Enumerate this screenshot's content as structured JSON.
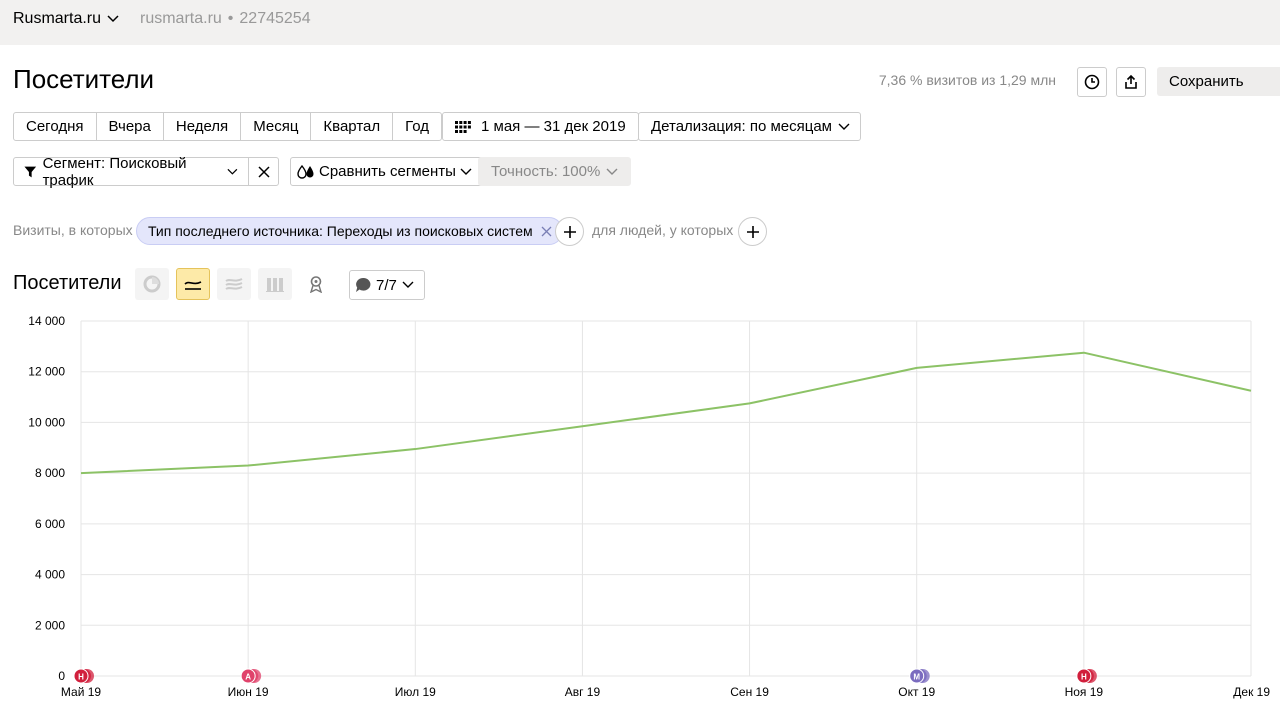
{
  "header": {
    "site_name": "Rusmarta.ru",
    "site_domain": "rusmarta.ru",
    "counter_id": "22745254"
  },
  "page": {
    "title": "Посетители",
    "visits_info": "7,36 % визитов из 1,29 млн",
    "save_label": "Сохранить"
  },
  "periods": [
    "Сегодня",
    "Вчера",
    "Неделя",
    "Месяц",
    "Квартал",
    "Год"
  ],
  "date_range": "1 мая — 31 дек 2019",
  "detail": "Детализация: по месяцам",
  "segment": {
    "label": "Сегмент: Поисковый трафик",
    "compare_label": "Сравнить сегменты",
    "accuracy_label": "Точность: 100%"
  },
  "filters": {
    "visits_label": "Визиты, в которых",
    "chip_label": "Тип последнего источника: Переходы из поисковых систем",
    "people_label": "для людей, у которых"
  },
  "chart_section": {
    "title": "Посетители",
    "annotations_count": "7/7"
  },
  "colors": {
    "line": "#8cc266",
    "grid": "#e5e5e5",
    "marker_red": "#d11f3c",
    "marker_pink": "#e0426b",
    "marker_purple": "#7a6bbf",
    "active_view": "#fdeaa8"
  },
  "chart_data": {
    "type": "line",
    "categories": [
      "Май 19",
      "Июн 19",
      "Июл 19",
      "Авг 19",
      "Сен 19",
      "Окт 19",
      "Ноя 19",
      "Дек 19"
    ],
    "series": [
      {
        "values": [
          8000,
          8300,
          8950,
          9850,
          10750,
          12150,
          12750,
          11250
        ]
      }
    ],
    "ylim": [
      0,
      14000
    ],
    "y_ticks": [
      "0",
      "2 000",
      "4 000",
      "6 000",
      "8 000",
      "10 000",
      "12 000",
      "14 000"
    ],
    "grid": true,
    "annotations": [
      {
        "x": "Май 19",
        "letter": "Н",
        "color": "#d11f3c"
      },
      {
        "x": "Июн 19",
        "letter": "А",
        "color": "#e0426b"
      },
      {
        "x": "Окт 19",
        "letter": "М",
        "color": "#7a6bbf"
      },
      {
        "x": "Ноя 19",
        "letter": "Н",
        "color": "#d11f3c"
      }
    ]
  }
}
